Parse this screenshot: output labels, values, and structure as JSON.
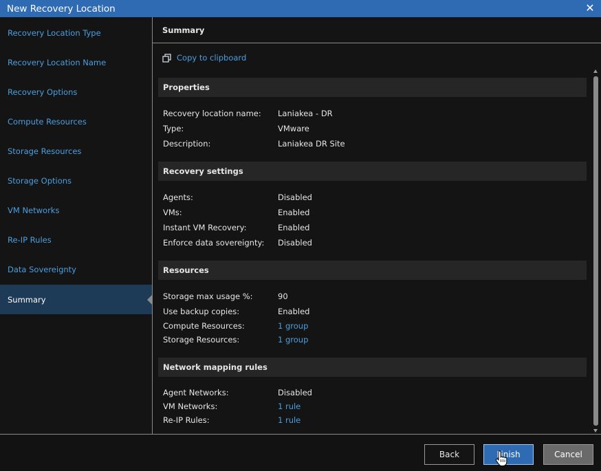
{
  "window": {
    "title": "New Recovery Location",
    "close_icon": "close-icon"
  },
  "sidebar": {
    "items": [
      {
        "label": "Recovery Location Type"
      },
      {
        "label": "Recovery Location Name"
      },
      {
        "label": "Recovery Options"
      },
      {
        "label": "Compute Resources"
      },
      {
        "label": "Storage Resources"
      },
      {
        "label": "Storage Options"
      },
      {
        "label": "VM Networks"
      },
      {
        "label": "Re-IP Rules"
      },
      {
        "label": "Data Sovereignty"
      },
      {
        "label": "Summary",
        "active": true
      }
    ]
  },
  "content": {
    "header": "Summary",
    "copy_label": "Copy to clipboard",
    "sections": [
      {
        "title": "Properties",
        "rows": [
          {
            "label": "Recovery location name:",
            "value": "Laniakea - DR"
          },
          {
            "label": "Type:",
            "value": "VMware"
          },
          {
            "label": "Description:",
            "value": "Laniakea DR Site"
          }
        ]
      },
      {
        "title": "Recovery settings",
        "rows": [
          {
            "label": "Agents:",
            "value": "Disabled"
          },
          {
            "label": "VMs:",
            "value": "Enabled"
          },
          {
            "label": "Instant VM Recovery:",
            "value": "Enabled"
          },
          {
            "label": "Enforce data sovereignty:",
            "value": "Disabled"
          }
        ]
      },
      {
        "title": "Resources",
        "rows": [
          {
            "label": "Storage max usage %:",
            "value": "90"
          },
          {
            "label": "Use backup copies:",
            "value": "Enabled"
          },
          {
            "label": "Compute Resources:",
            "value": "1 group",
            "link": true
          },
          {
            "label": "Storage Resources:",
            "value": "1 group",
            "link": true
          }
        ]
      },
      {
        "title": "Network mapping rules",
        "rows": [
          {
            "label": "Agent Networks:",
            "value": "Disabled"
          },
          {
            "label": "VM Networks:",
            "value": "1 rule",
            "link": true
          },
          {
            "label": "Re-IP Rules:",
            "value": "1 rule",
            "link": true
          }
        ]
      }
    ]
  },
  "footer": {
    "back_label": "Back",
    "finish_label": "Finish",
    "cancel_label": "Cancel"
  },
  "colors": {
    "accent": "#2f6bb2",
    "link": "#4a9fe0",
    "background": "#141414"
  }
}
